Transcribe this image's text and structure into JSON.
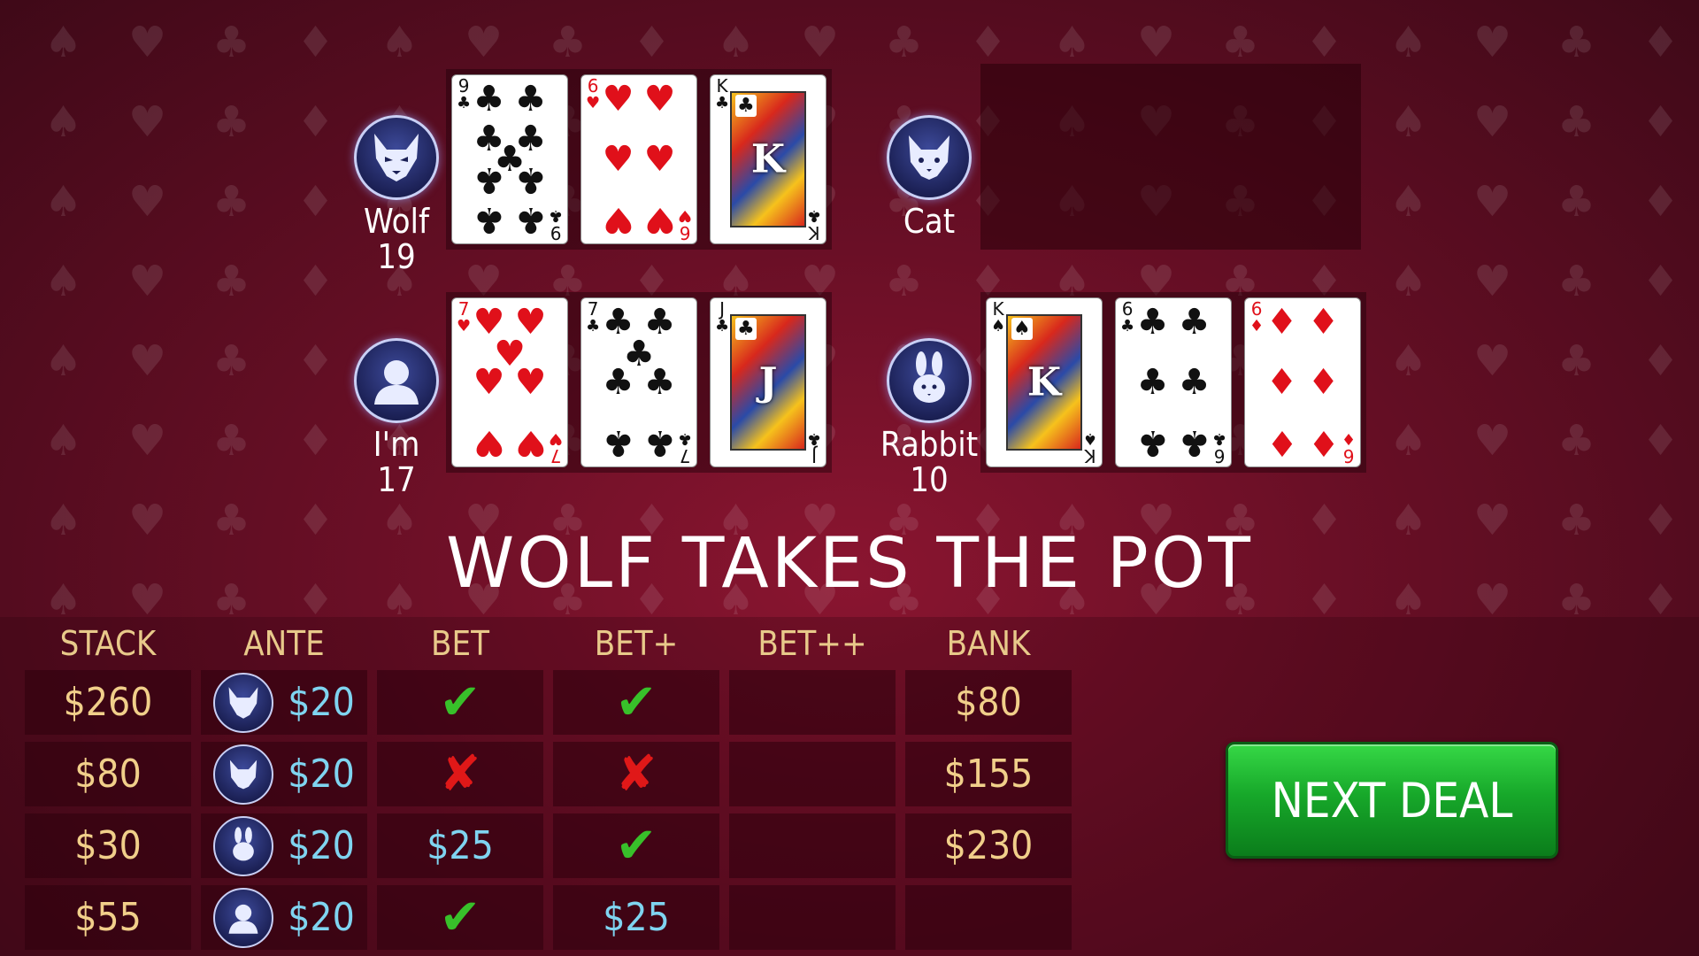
{
  "players": [
    {
      "name": "Wolf",
      "score": "19",
      "icon": "wolf-icon",
      "cards": [
        {
          "rank": "9",
          "suit": "♣",
          "color": "black"
        },
        {
          "rank": "6",
          "suit": "♥",
          "color": "red"
        },
        {
          "rank": "K",
          "suit": "♣",
          "color": "black"
        }
      ]
    },
    {
      "name": "Cat",
      "score": "",
      "icon": "cat-icon",
      "cards": []
    },
    {
      "name": "I'm",
      "score": "17",
      "icon": "user-icon",
      "cards": [
        {
          "rank": "7",
          "suit": "♥",
          "color": "red"
        },
        {
          "rank": "7",
          "suit": "♣",
          "color": "black"
        },
        {
          "rank": "J",
          "suit": "♣",
          "color": "black"
        }
      ]
    },
    {
      "name": "Rabbit",
      "score": "10",
      "icon": "rabbit-icon",
      "cards": [
        {
          "rank": "K",
          "suit": "♠",
          "color": "black"
        },
        {
          "rank": "6",
          "suit": "♣",
          "color": "black"
        },
        {
          "rank": "6",
          "suit": "♦",
          "color": "red"
        }
      ]
    }
  ],
  "result_text": "WOLF TAKES THE POT",
  "table": {
    "headers": [
      "STACK",
      "ANTE",
      "BET",
      "BET+",
      "BET++",
      "BANK"
    ],
    "rows": [
      {
        "stack": "$260",
        "icon": "wolf-icon",
        "ante": "$20",
        "bet": "check",
        "bet_plus": "check",
        "bet_pp": "",
        "bank": "$80"
      },
      {
        "stack": "$80",
        "icon": "cat-icon",
        "ante": "$20",
        "bet": "cross",
        "bet_plus": "cross",
        "bet_pp": "",
        "bank": "$155"
      },
      {
        "stack": "$30",
        "icon": "rabbit-icon",
        "ante": "$20",
        "bet": "$25",
        "bet_plus": "check",
        "bet_pp": "",
        "bank": "$230"
      },
      {
        "stack": "$55",
        "icon": "user-icon",
        "ante": "$20",
        "bet": "check",
        "bet_plus": "$25",
        "bet_pp": "",
        "bank": ""
      }
    ]
  },
  "next_button": "NEXT DEAL",
  "colors": {
    "accent_gold": "#f1cf8a",
    "accent_blue": "#7fd4f0",
    "check_green": "#38c02a",
    "cross_red": "#e01818",
    "button_green": "#17a82a"
  }
}
